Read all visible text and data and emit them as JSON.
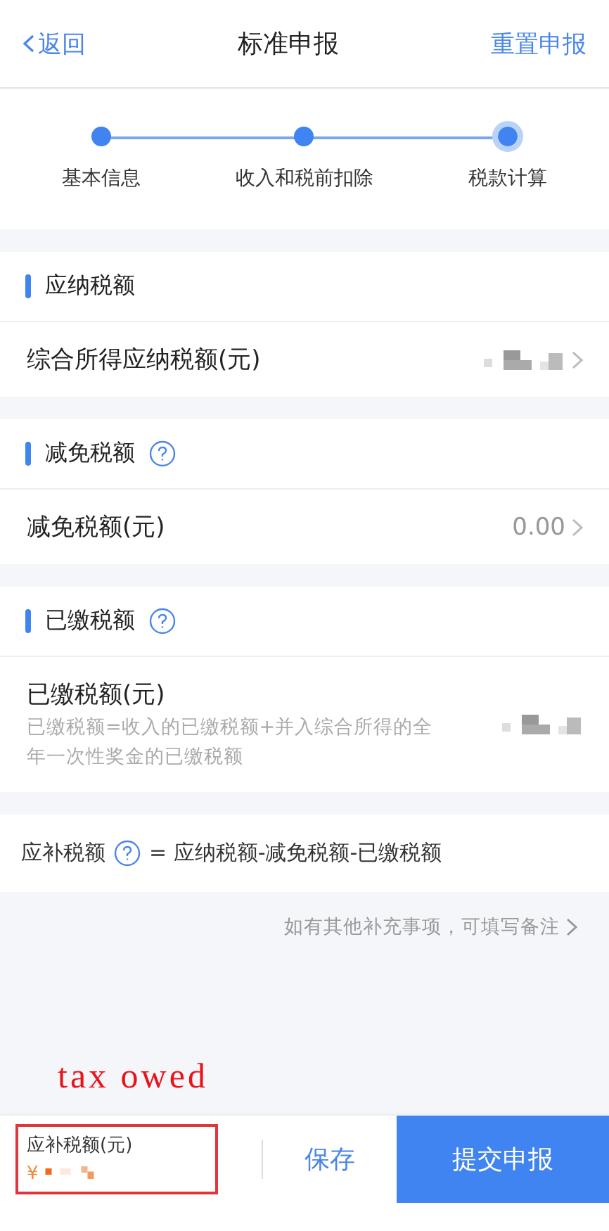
{
  "nav": {
    "back": "返回",
    "title": "标准申报",
    "action": "重置申报"
  },
  "steps": [
    {
      "label": "基本信息",
      "current": false
    },
    {
      "label": "收入和税前扣除",
      "current": false
    },
    {
      "label": "税款计算",
      "current": true
    }
  ],
  "sections": [
    {
      "title": "应纳税额",
      "help": false,
      "row": {
        "label": "综合所得应纳税额(元)",
        "value_redacted": true,
        "chevron": true
      }
    },
    {
      "title": "减免税额",
      "help": true,
      "row": {
        "label": "减免税额(元)",
        "value": "0.00",
        "chevron": true
      }
    },
    {
      "title": "已缴税额",
      "help": true,
      "row": {
        "label": "已缴税额(元)",
        "note": "已缴税额=收入的已缴税额+并入综合所得的全年一次性奖金的已缴税额",
        "value_redacted": true,
        "chevron": false
      }
    }
  ],
  "formula": {
    "label": "应补税额",
    "expression": "= 应纳税额-减免税额-已缴税额"
  },
  "remark_link": "如有其他补充事项，可填写备注",
  "annotation": "tax owed",
  "bottom_bar": {
    "label": "应补税额(元)",
    "currency": "¥",
    "amount_redacted": true,
    "save": "保存",
    "submit": "提交申报"
  }
}
